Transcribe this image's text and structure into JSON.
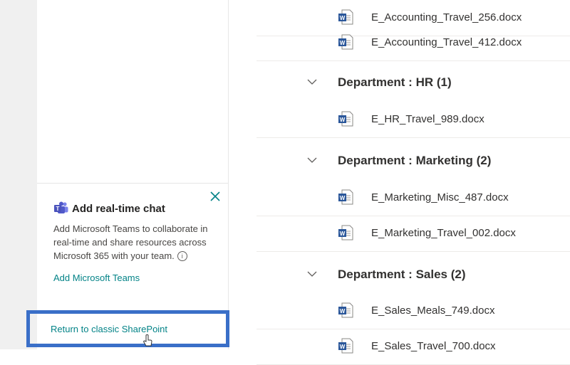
{
  "teams_card": {
    "title": "Add real-time chat",
    "description": "Add Microsoft Teams to collaborate in real-time and share resources across Microsoft 365 with your team.",
    "info_glyph": "i",
    "link": "Add Microsoft Teams",
    "close_icon": "close-icon",
    "teams_icon": "teams-icon"
  },
  "footer": {
    "classic_link": "Return to classic SharePoint"
  },
  "list": {
    "rows": [
      {
        "kind": "file",
        "name": "E_Accounting_Travel_256.docx"
      },
      {
        "kind": "file",
        "name": "E_Accounting_Travel_412.docx"
      },
      {
        "kind": "group",
        "title": "Department : HR (1)"
      },
      {
        "kind": "file",
        "name": "E_HR_Travel_989.docx"
      },
      {
        "kind": "group",
        "title": "Department : Marketing (2)"
      },
      {
        "kind": "file",
        "name": "E_Marketing_Misc_487.docx"
      },
      {
        "kind": "file",
        "name": "E_Marketing_Travel_002.docx"
      },
      {
        "kind": "group",
        "title": "Department : Sales (2)"
      },
      {
        "kind": "file",
        "name": "E_Sales_Meals_749.docx"
      },
      {
        "kind": "file",
        "name": "E_Sales_Travel_700.docx"
      }
    ]
  },
  "colors": {
    "link": "#038387",
    "highlight_box": "#3a6fc8",
    "word_blue": "#2b579a"
  }
}
